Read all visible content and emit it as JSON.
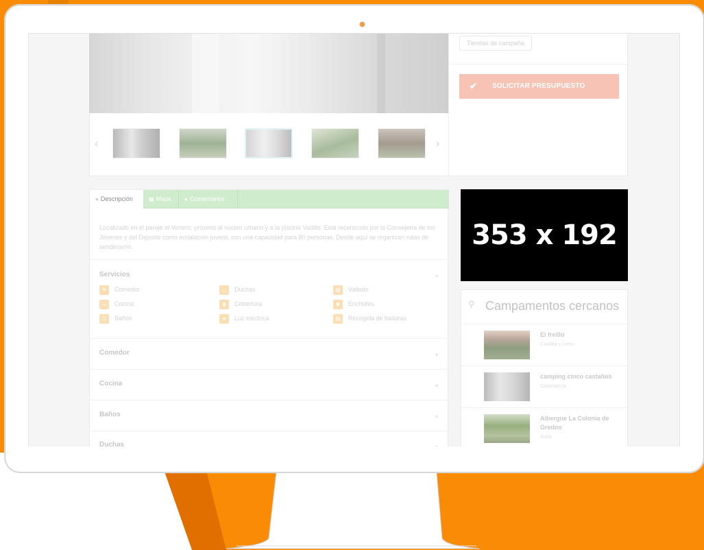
{
  "colors": {
    "background_orange": "#fa8b05",
    "background_orange_dark": "#e06f00",
    "button_faded": "#f6c3b5",
    "tabs_faded": "#cfeccd",
    "service_icon_faded": "#f9dfb3",
    "camera_dot": "#f39c40"
  },
  "gallery": {
    "thumbnails": [
      "thumb-1",
      "thumb-2",
      "thumb-3",
      "thumb-4",
      "thumb-5"
    ],
    "active_index": 3,
    "prev_icon": "chevron-left-icon",
    "next_icon": "chevron-right-icon"
  },
  "sidebar": {
    "tag": "Tiendas de campaña",
    "quote_button": "SOLICITAR PRESUPUESTO",
    "quote_icon": "checkmark-icon"
  },
  "tabs": [
    {
      "label": "Descripción",
      "icon": "info-icon"
    },
    {
      "label": "Maps",
      "icon": "map-icon"
    },
    {
      "label": "Comentarios",
      "icon": "comment-icon"
    }
  ],
  "description": "Localizado en el paraje el Venero, próximo al núcleo urbano y a la piscina Vadillo. Está reconocido por la Consejería de los Jóvenes y del Deporte como instalación juvenil, con una capacidad para 80 personas. Desde aquí se organizan rutas de senderismo.",
  "services": {
    "title": "Servicios",
    "items": [
      {
        "label": "Comedor",
        "icon": "wrench-icon"
      },
      {
        "label": "Duchas",
        "icon": "shower-icon"
      },
      {
        "label": "Vallado",
        "icon": "fence-icon"
      },
      {
        "label": "Cocina",
        "icon": "cooking-icon"
      },
      {
        "label": "Cobertura",
        "icon": "signal-icon"
      },
      {
        "label": "Enchufes",
        "icon": "plug-icon"
      },
      {
        "label": "Baños",
        "icon": "toilet-icon"
      },
      {
        "label": "Luz eléctrica",
        "icon": "bulb-icon"
      },
      {
        "label": "Recogida de basuras",
        "icon": "trash-icon"
      }
    ]
  },
  "accordion": [
    "Comedor",
    "Cocina",
    "Baños",
    "Duchas"
  ],
  "ad": {
    "text": "353 x 192"
  },
  "nearby": {
    "title": "Campamentos cercanos",
    "icon": "map-pin-icon",
    "items": [
      {
        "name": "El freillo",
        "location": "Castilla y León"
      },
      {
        "name": "camping cinco castaños",
        "location": "Salamanca"
      },
      {
        "name": "Albergue La Colonia de Gredos",
        "location": "Ávila"
      }
    ]
  }
}
